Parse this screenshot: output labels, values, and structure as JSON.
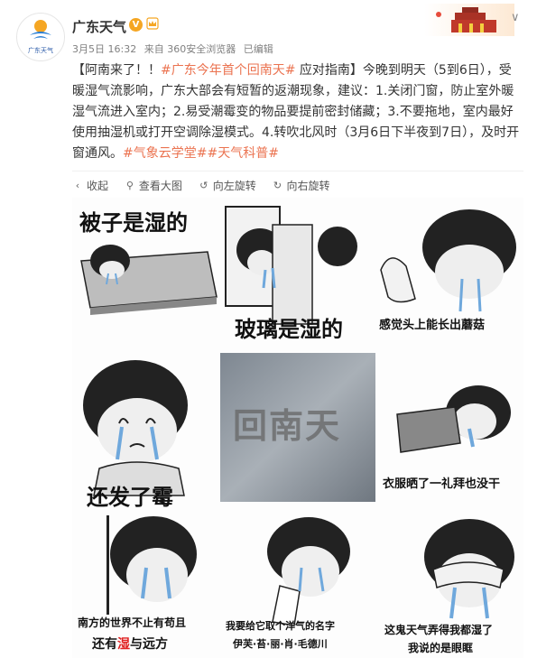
{
  "account": {
    "name": "广东天气",
    "avatar_text": "广东天气",
    "verified_mark": "V",
    "time": "3月5日 16:32",
    "source": "来自 360安全浏览器",
    "edited": "已编辑"
  },
  "post": {
    "part1": "【阿南来了！！",
    "tag1": "#广东今年首个回南天#",
    "part2": " 应对指南】今晚到明天（5到6日），受暖湿气流影响，广东大部会有短暂的返潮现象，建议：1.关闭门窗，防止室外暖湿气流进入室内；2.易受潮霉变的物品要提前密封储藏；3.不要拖地，室内最好使用抽湿机或打开空调除湿模式。4.转吹北风时（3月6日下半夜到7日），及时开窗通风。",
    "tag2": "#气象云学堂#",
    "tag3": "#天气科普#"
  },
  "toolbar": {
    "collapse": "收起",
    "view_large": "查看大图",
    "rotate_left": "向左旋转",
    "rotate_right": "向右旋转"
  },
  "meme": {
    "cap_bed": "被子是湿的",
    "cap_glass": "玻璃是湿的",
    "cap_mushroom": "感觉头上能长出蘑菇",
    "center_text": "回南天",
    "cap_mold": "还发了霉",
    "cap_clothes": "衣服晒了一礼拜也没干",
    "cap_south_l1": "南方的世界不止有苟且",
    "cap_south_l2a": "还有",
    "cap_south_l2b": "湿",
    "cap_south_l2c": "与远方",
    "cap_name_l1": "我要给它取个洋气的名字",
    "cap_name_l2": "伊芙·苔·丽·肖·毛德川",
    "cap_eyes_l1": "这鬼天气弄得我都湿了",
    "cap_eyes_l2": "我说的是眼眶"
  },
  "colors": {
    "tag": "#eb7350",
    "verified": "#f5a623",
    "highlight": "#e02020"
  }
}
